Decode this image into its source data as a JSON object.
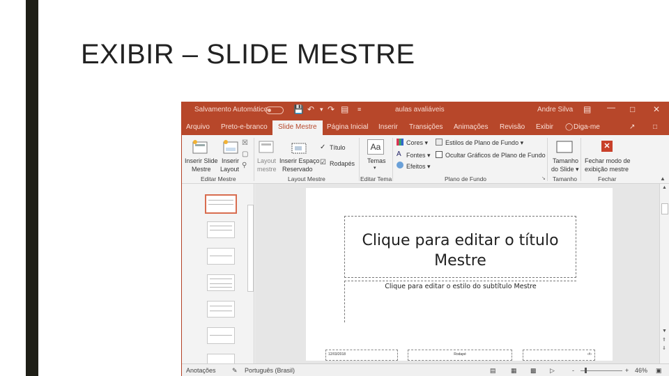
{
  "slide": {
    "title": "EXIBIR – SLIDE MESTRE"
  },
  "app": {
    "titlebar": {
      "autosave": "Salvamento Automático",
      "filename": "aulas avaliáveis",
      "user": "Andre Silva"
    },
    "tabs": [
      {
        "label": "Arquivo"
      },
      {
        "label": "Preto-e-branco"
      },
      {
        "label": "Slide Mestre",
        "active": true
      },
      {
        "label": "Página Inicial"
      },
      {
        "label": "Inserir"
      },
      {
        "label": "Transições"
      },
      {
        "label": "Animações"
      },
      {
        "label": "Revisão"
      },
      {
        "label": "Exibir"
      },
      {
        "label": "Diga-me"
      }
    ],
    "ribbon": {
      "insert_slide_master": [
        "Inserir Slide",
        "Mestre"
      ],
      "insert_layout": [
        "Inserir",
        "Layout"
      ],
      "layout_master": [
        "Layout",
        "mestre"
      ],
      "insert_placeholder": [
        "Inserir Espaço",
        "Reservado"
      ],
      "title_check": "Título",
      "footers_check": "Rodapés",
      "themes": "Temas",
      "colors": "Cores",
      "fonts": "Fontes",
      "effects": "Efeitos",
      "bg_styles": "Estilos de Plano de Fundo",
      "hide_bg": "Ocultar Gráficos de Plano de Fundo",
      "slide_size": [
        "Tamanho",
        "do Slide"
      ],
      "close_master": [
        "Fechar modo de",
        "exibição mestre"
      ],
      "groups": {
        "edit_master": "Editar Mestre",
        "master_layout": "Layout Mestre",
        "edit_theme": "Editar Tema",
        "background": "Plano de Fundo",
        "size": "Tamanho",
        "close": "Fechar"
      },
      "font_icon": "Aa"
    },
    "canvas": {
      "title_placeholder": [
        "Clique para editar o título",
        "Mestre"
      ],
      "subtitle_placeholder": "Clique para editar o estilo do subtítulo Mestre",
      "footer_date": "12/03/2018",
      "footer_text": "Rodapé",
      "footer_num": "‹#›"
    },
    "status": {
      "notes": "Anotações",
      "language": "Português (Brasil)",
      "zoom_minus": "-",
      "zoom_plus": "+",
      "zoom": "46%"
    }
  }
}
